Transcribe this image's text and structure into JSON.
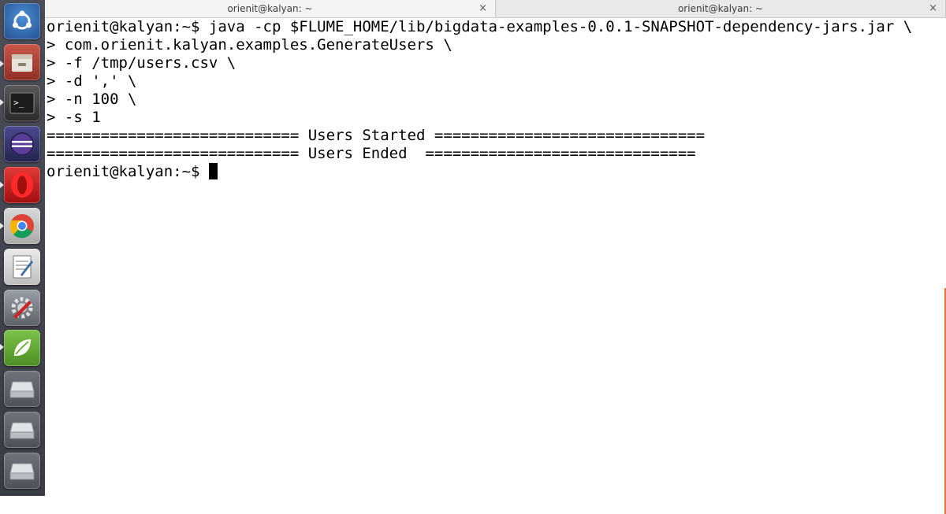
{
  "window": {
    "tabs": [
      {
        "title": "orienit@kalyan: ~",
        "active": true
      },
      {
        "title": "orienit@kalyan: ~",
        "active": false
      }
    ],
    "close_glyph": "×"
  },
  "launcher": {
    "items": [
      {
        "name": "ubuntu-dash-icon",
        "color": "#2f6fb0"
      },
      {
        "name": "files-icon",
        "color": "#b5473a"
      },
      {
        "name": "terminal-icon",
        "color": "#2b2b2b"
      },
      {
        "name": "eclipse-icon",
        "color": "#3b2b6b"
      },
      {
        "name": "opera-icon",
        "color": "#d21b1b"
      },
      {
        "name": "chrome-icon",
        "color": "#e0e0e0"
      },
      {
        "name": "text-editor-icon",
        "color": "#d8d8d8"
      },
      {
        "name": "system-settings-icon",
        "color": "#8a8f98"
      },
      {
        "name": "spring-tool-suite-icon",
        "color": "#6fb33f"
      },
      {
        "name": "drive-icon",
        "color": "#c9ccd1"
      },
      {
        "name": "drive-icon",
        "color": "#c9ccd1"
      },
      {
        "name": "drive-icon",
        "color": "#c9ccd1"
      }
    ]
  },
  "terminal": {
    "lines": [
      "orienit@kalyan:~$ java -cp $FLUME_HOME/lib/bigdata-examples-0.0.1-SNAPSHOT-dependency-jars.jar \\",
      "> com.orienit.kalyan.examples.GenerateUsers \\",
      "> -f /tmp/users.csv \\",
      "> -d ',' \\",
      "> -n 100 \\",
      "> -s 1",
      "============================ Users Started ==============================",
      "============================ Users Ended  =============================="
    ],
    "prompt": "orienit@kalyan:~$ "
  }
}
